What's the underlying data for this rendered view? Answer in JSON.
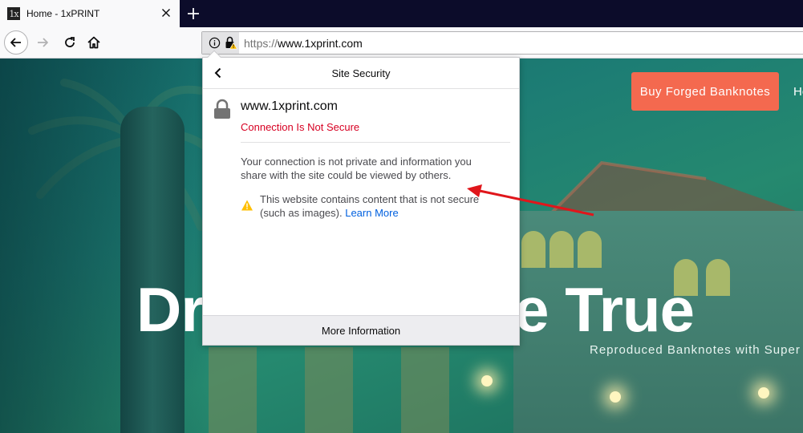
{
  "browser": {
    "tab": {
      "favicon_text": "1x",
      "title": "Home - 1xPRINT"
    },
    "url": {
      "scheme": "https://",
      "host": "www.1xprint.com"
    }
  },
  "page": {
    "cta_button": "Buy Forged Banknotes",
    "nav_partial": "Ho",
    "hero_title": "Dreams Come True",
    "hero_subtitle": "Reproduced Banknotes with Super"
  },
  "popup": {
    "title": "Site Security",
    "host": "www.1xprint.com",
    "status": "Connection Is Not Secure",
    "description": "Your connection is not private and information you share with the site could be viewed by others.",
    "warning": "This website contains content that is not secure (such as images).",
    "learn_more": "Learn More",
    "more_info": "More Information"
  },
  "colors": {
    "insecure_red": "#d70022",
    "link_blue": "#0060df",
    "cta_orange": "#f4694f",
    "warning_yellow": "#ffbf00",
    "annotation_red": "#e0161b"
  },
  "icons": [
    "back-icon",
    "forward-icon",
    "reload-icon",
    "home-icon",
    "info-icon",
    "insecure-lock-icon",
    "warning-icon",
    "close-icon",
    "plus-icon"
  ]
}
